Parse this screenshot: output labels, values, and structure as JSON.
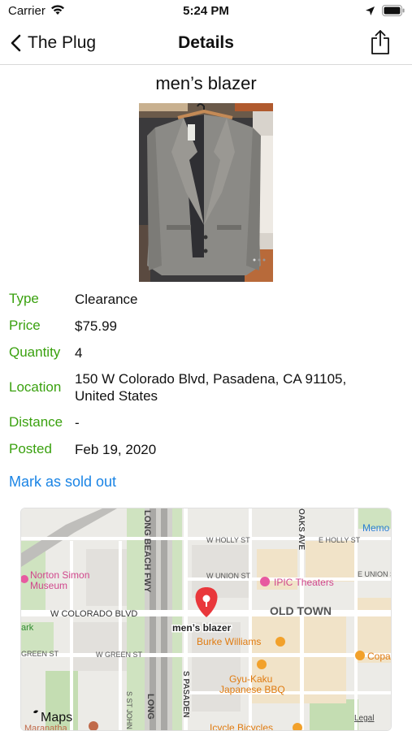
{
  "status_bar": {
    "carrier": "Carrier",
    "time": "5:24 PM"
  },
  "nav": {
    "back_label": "The Plug",
    "title": "Details"
  },
  "item": {
    "title": "men’s blazer"
  },
  "details": {
    "type": {
      "label": "Type",
      "value": "Clearance"
    },
    "price": {
      "label": "Price",
      "value": "$75.99"
    },
    "quantity": {
      "label": "Quantity",
      "value": "4"
    },
    "location": {
      "label": "Location",
      "line1": "150 W Colorado Blvd, Pasadena, CA  91105,",
      "line2": "United States"
    },
    "distance": {
      "label": "Distance",
      "value": "-"
    },
    "posted": {
      "label": "Posted",
      "value": "Feb 19, 2020"
    }
  },
  "actions": {
    "mark_sold": "Mark as sold out"
  },
  "map": {
    "pin_label": "men’s blazer",
    "streets": {
      "w_holly": "W HOLLY ST",
      "e_holly": "E HOLLY ST",
      "w_union": "W UNION ST",
      "e_union": "E UNION S",
      "w_colorado": "W COLORADO BLVD",
      "w_green": "W GREEN ST",
      "green_left": "GREEN ST",
      "beachfwy": "LONG BEACH FWY",
      "oaks_ave": "OAKS AVE",
      "s_pasaden": "S PASADEN",
      "s_st_john": "S ST JOHN",
      "long_bottom": "LONG",
      "ark": "ark"
    },
    "places": {
      "norton1": "Norton Simon",
      "norton2": "Museum",
      "ipic": "IPIC Theaters",
      "old_town": "OLD TOWN",
      "burke": "Burke Williams",
      "gyu1": "Gyu-Kaku",
      "gyu2": "Japanese BBQ",
      "copa": "Copa",
      "memo": "Memo",
      "icycle": "Icycle Bicycles",
      "maranatha": "Maranatha"
    },
    "brand": "Maps",
    "legal": "Legal"
  },
  "colors": {
    "accent_green": "#3aa10f",
    "link_blue": "#1a84e5",
    "pin_red": "#e9373b"
  }
}
